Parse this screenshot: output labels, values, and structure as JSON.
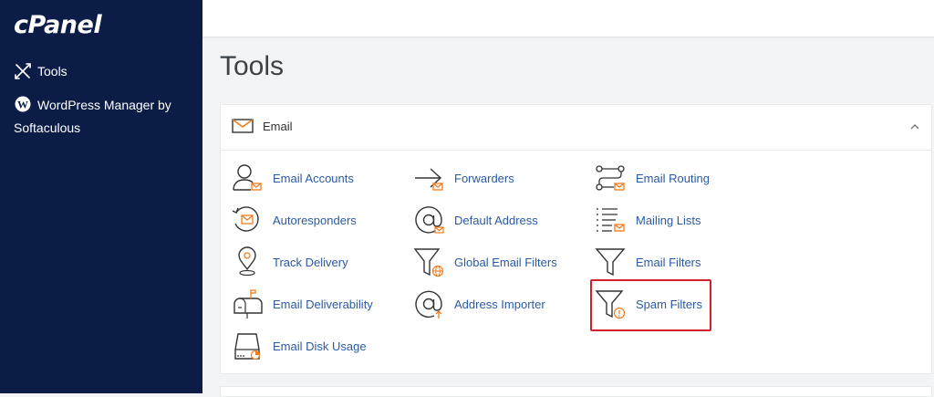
{
  "sidebar": {
    "logo": "cPanel",
    "items": [
      {
        "label": "Tools",
        "icon": "tools-icon"
      },
      {
        "label": "WordPress Manager by Softaculous",
        "icon": "wordpress-icon"
      }
    ]
  },
  "main": {
    "title": "Tools",
    "section": {
      "title": "Email",
      "tools": [
        {
          "label": "Email Accounts",
          "icon": "email-accounts-icon"
        },
        {
          "label": "Forwarders",
          "icon": "forwarders-icon"
        },
        {
          "label": "Email Routing",
          "icon": "email-routing-icon"
        },
        {
          "label": "Autoresponders",
          "icon": "autoresponders-icon"
        },
        {
          "label": "Default Address",
          "icon": "default-address-icon"
        },
        {
          "label": "Mailing Lists",
          "icon": "mailing-lists-icon"
        },
        {
          "label": "Track Delivery",
          "icon": "track-delivery-icon"
        },
        {
          "label": "Global Email Filters",
          "icon": "global-email-filters-icon"
        },
        {
          "label": "Email Filters",
          "icon": "email-filters-icon"
        },
        {
          "label": "Email Deliverability",
          "icon": "email-deliverability-icon"
        },
        {
          "label": "Address Importer",
          "icon": "address-importer-icon"
        },
        {
          "label": "Spam Filters",
          "icon": "spam-filters-icon"
        },
        {
          "label": "Email Disk Usage",
          "icon": "email-disk-usage-icon"
        }
      ]
    }
  },
  "colors": {
    "sidebar_bg": "#0b1d46",
    "link": "#2a5aa3",
    "accent": "#f07c1e",
    "highlight": "#d2202f"
  }
}
